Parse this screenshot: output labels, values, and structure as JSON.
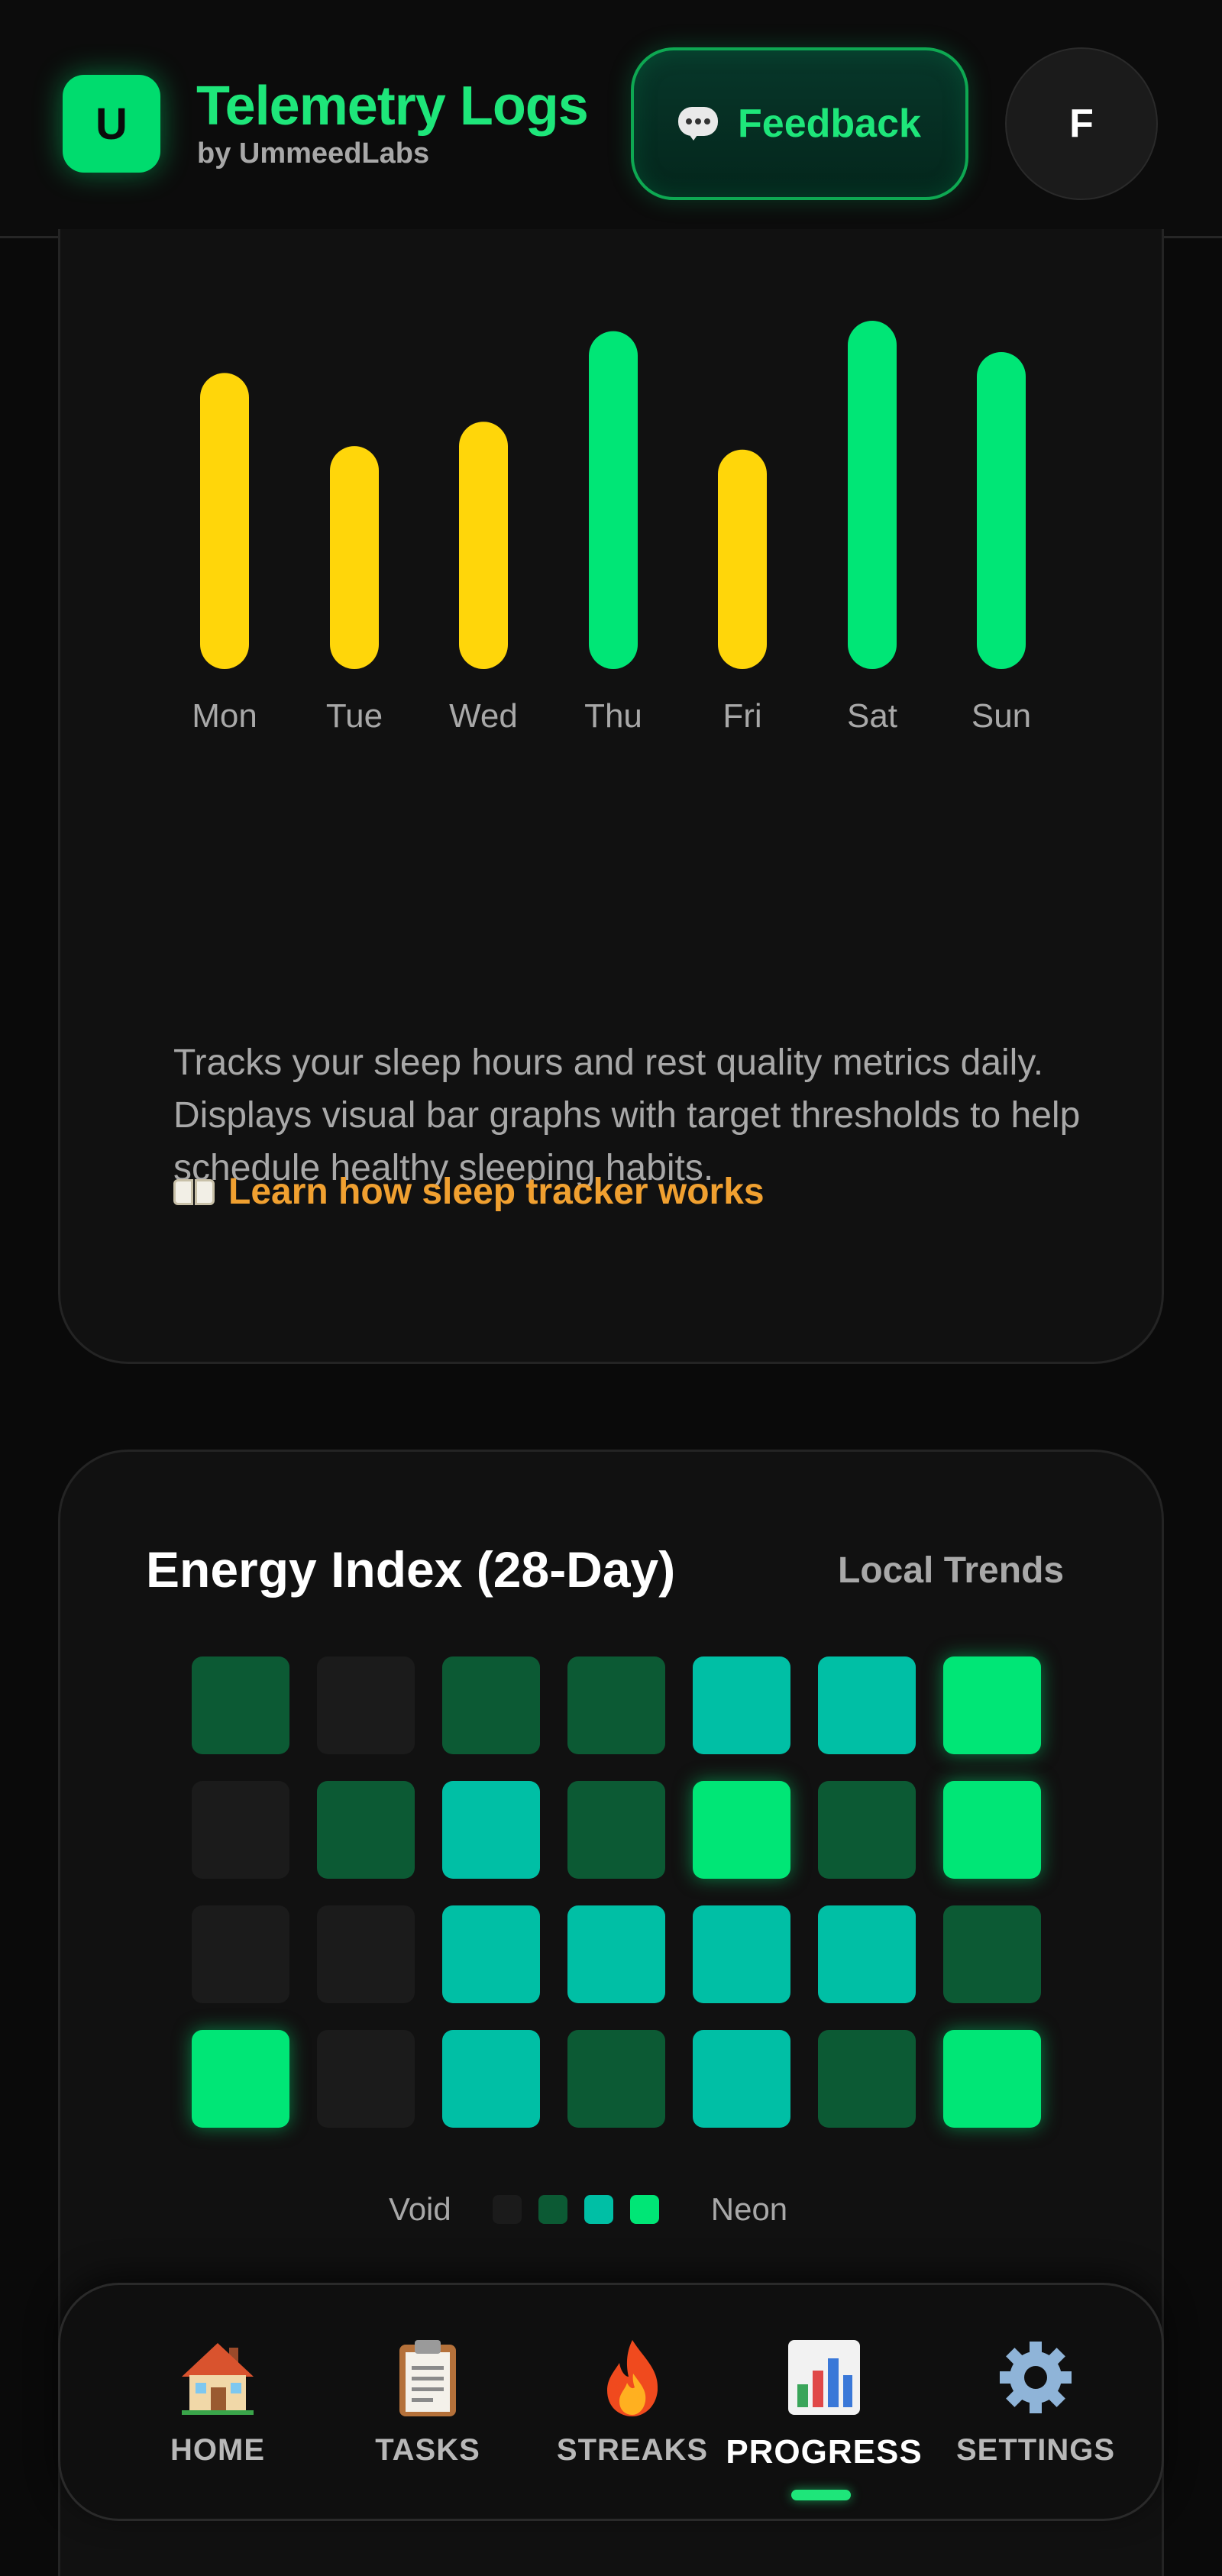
{
  "header": {
    "logo_letter": "U",
    "title": "Telemetry Logs",
    "subtitle": "by UmmeedLabs",
    "feedback_label": "Feedback",
    "avatar_letter": "F"
  },
  "sleep_card": {
    "description": "Tracks your sleep hours and rest quality metrics daily. Displays visual bar graphs with target thresholds to help schedule healthy sleeping habits.",
    "learn_link": "Learn how sleep tracker works",
    "colors": {
      "below_target": "#ffd60a",
      "on_target": "#00e676"
    }
  },
  "chart_data": {
    "type": "bar",
    "categories": [
      "Mon",
      "Tue",
      "Wed",
      "Thu",
      "Fri",
      "Sat",
      "Sun"
    ],
    "values": [
      0.85,
      0.64,
      0.71,
      0.97,
      0.63,
      1.0,
      0.91
    ],
    "value_unit": "fraction of tallest bar",
    "bar_colors": [
      "#ffd60a",
      "#ffd60a",
      "#ffd60a",
      "#00e676",
      "#ffd60a",
      "#00e676",
      "#00e676"
    ],
    "title": "",
    "xlabel": "",
    "ylabel": "",
    "ylim": [
      0,
      1
    ],
    "grid": false
  },
  "energy_card": {
    "title": "Energy Index (28-Day)",
    "subtitle": "Local Trends",
    "levels": [
      [
        1,
        0,
        1,
        1,
        2,
        2,
        3
      ],
      [
        0,
        1,
        2,
        1,
        3,
        1,
        3
      ],
      [
        0,
        0,
        2,
        2,
        2,
        2,
        1
      ],
      [
        3,
        0,
        2,
        1,
        2,
        1,
        3
      ]
    ],
    "level_colors": [
      "#1b1b1b",
      "#0c5a34",
      "#00bfa5",
      "#00e676"
    ],
    "legend_low": "Void",
    "legend_high": "Neon"
  },
  "nav": {
    "items": [
      {
        "label": "HOME",
        "icon": "house-icon"
      },
      {
        "label": "TASKS",
        "icon": "clipboard-icon"
      },
      {
        "label": "STREAKS",
        "icon": "fire-icon"
      },
      {
        "label": "PROGRESS",
        "icon": "bar-chart-icon"
      },
      {
        "label": "SETTINGS",
        "icon": "gear-icon"
      }
    ],
    "active": "PROGRESS"
  }
}
